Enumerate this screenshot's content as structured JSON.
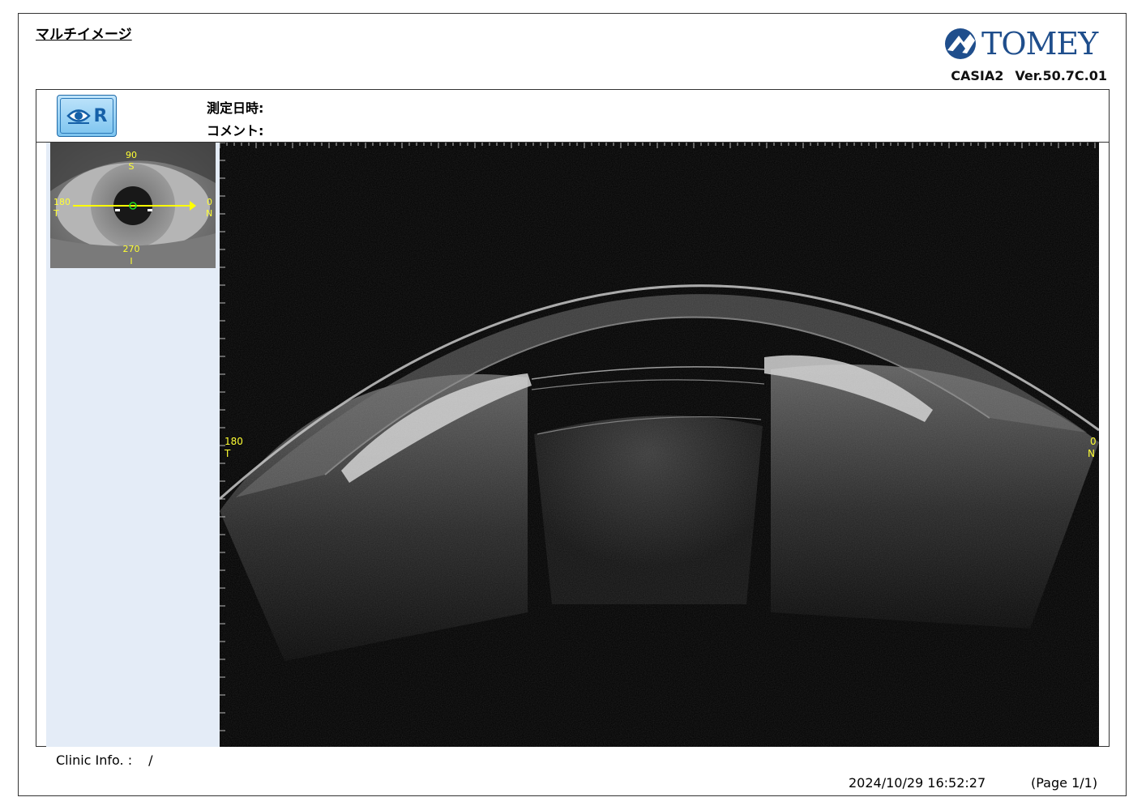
{
  "report": {
    "title": "マルチイメージ",
    "brand": "TOMEY",
    "model": "CASIA2",
    "version": "Ver.50.7C.01"
  },
  "header": {
    "eye_side": "R",
    "date_label": "測定日時:",
    "comment_label": "コメント:"
  },
  "thumbnail": {
    "top_angle": "90",
    "top_dir": "S",
    "left_angle": "180",
    "left_dir": "T",
    "right_angle": "0",
    "right_dir": "N",
    "bottom_angle": "270",
    "bottom_dir": "I"
  },
  "oct": {
    "left_angle": "180",
    "left_dir": "T",
    "right_angle": "0",
    "right_dir": "N"
  },
  "footer": {
    "clinic_label": "Clinic Info. :",
    "clinic_value": "/",
    "datetime": "2024/10/29 16:52:27",
    "page": "(Page 1/1)"
  },
  "colors": {
    "brand_blue": "#1f4e8c",
    "sidebar_bg": "#e4ecf7",
    "label_yellow": "#ffff33",
    "scan_line": "#ffff00"
  }
}
